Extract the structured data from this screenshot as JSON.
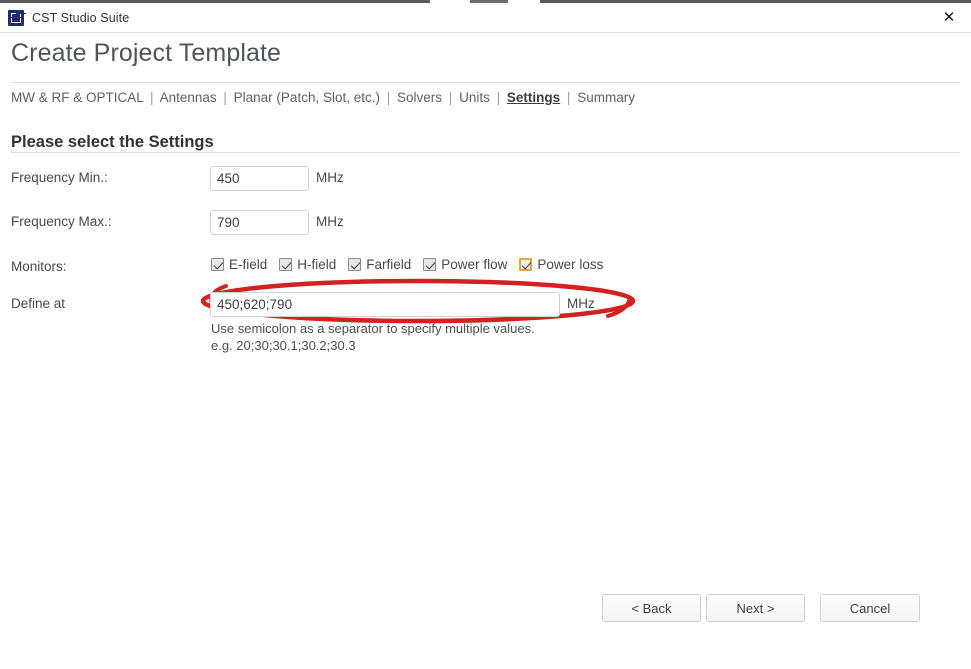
{
  "window": {
    "app_title": "CST Studio Suite",
    "logo_icon": "cst-logo-icon",
    "close_icon": "✕",
    "logo_color": "#1f2d6e"
  },
  "page": {
    "title": "Create Project Template",
    "section_heading": "Please select the Settings"
  },
  "breadcrumb": {
    "separator": "|",
    "items": [
      {
        "label": "MW & RF & OPTICAL",
        "active": false
      },
      {
        "label": "Antennas",
        "active": false
      },
      {
        "label": "Planar (Patch, Slot, etc.)",
        "active": false
      },
      {
        "label": "Solvers",
        "active": false
      },
      {
        "label": "Units",
        "active": false
      },
      {
        "label": "Settings",
        "active": true
      },
      {
        "label": "Summary",
        "active": false
      }
    ]
  },
  "form": {
    "frequency_min": {
      "label": "Frequency Min.:",
      "value": "450",
      "unit": "MHz"
    },
    "frequency_max": {
      "label": "Frequency Max.:",
      "value": "790",
      "unit": "MHz"
    },
    "monitors": {
      "label": "Monitors:",
      "options": [
        {
          "label": "E-field",
          "checked": true,
          "focused": false
        },
        {
          "label": "H-field",
          "checked": true,
          "focused": false
        },
        {
          "label": "Farfield",
          "checked": true,
          "focused": false
        },
        {
          "label": "Power flow",
          "checked": true,
          "focused": false
        },
        {
          "label": "Power loss",
          "checked": true,
          "focused": true
        }
      ]
    },
    "define_at": {
      "label": "Define at",
      "value": "450;620;790",
      "unit": "MHz",
      "helper_line1": "Use semicolon as a separator to specify multiple values.",
      "helper_line2": "e.g. 20;30;30.1;30.2;30.3"
    }
  },
  "annotation": {
    "shape": "ellipse",
    "color": "#d32020",
    "target": "monitors-checkbox-group"
  },
  "footer": {
    "back_label": "< Back",
    "next_label": "Next >",
    "cancel_label": "Cancel"
  }
}
